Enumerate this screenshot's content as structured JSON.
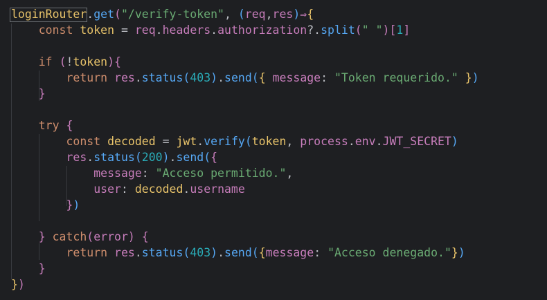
{
  "theme": {
    "background": "#1e1f22",
    "colors": {
      "text": "#bcbec4",
      "identifier": "#e8c36a",
      "property": "#c77dbb",
      "method": "#56a8f5",
      "keyword": "#cf8e6d",
      "string": "#6aab73",
      "number": "#2aacb8",
      "brace1": "#e8c36a",
      "brace2": "#c77dbb",
      "brace3": "#56a8f5",
      "guide": "#393b40"
    }
  },
  "code_lines": [
    [
      {
        "t": "loginRouter",
        "c": "identifier"
      },
      {
        "t": ".",
        "c": "text"
      },
      {
        "t": "get",
        "c": "method"
      },
      {
        "t": "(",
        "c": "brace2"
      },
      {
        "t": "\"/verify-token\"",
        "c": "string"
      },
      {
        "t": ", ",
        "c": "text"
      },
      {
        "t": "(",
        "c": "brace3"
      },
      {
        "t": "req",
        "c": "property"
      },
      {
        "t": ",",
        "c": "text"
      },
      {
        "t": "res",
        "c": "property"
      },
      {
        "t": ")",
        "c": "brace3"
      },
      {
        "t": "⇒",
        "c": "property"
      },
      {
        "t": "{",
        "c": "brace1"
      }
    ],
    [
      {
        "t": "    ",
        "c": "text"
      },
      {
        "t": "const",
        "c": "keyword"
      },
      {
        "t": " ",
        "c": "text"
      },
      {
        "t": "token",
        "c": "identifier"
      },
      {
        "t": " = ",
        "c": "text"
      },
      {
        "t": "req",
        "c": "property"
      },
      {
        "t": ".",
        "c": "text"
      },
      {
        "t": "headers",
        "c": "property"
      },
      {
        "t": ".",
        "c": "text"
      },
      {
        "t": "authorization",
        "c": "property"
      },
      {
        "t": "?.",
        "c": "text"
      },
      {
        "t": "split",
        "c": "method"
      },
      {
        "t": "(",
        "c": "brace2"
      },
      {
        "t": "\" \"",
        "c": "string"
      },
      {
        "t": ")",
        "c": "brace2"
      },
      {
        "t": "[",
        "c": "brace2"
      },
      {
        "t": "1",
        "c": "number"
      },
      {
        "t": "]",
        "c": "brace2"
      }
    ],
    [],
    [
      {
        "t": "    ",
        "c": "text"
      },
      {
        "t": "if",
        "c": "keyword"
      },
      {
        "t": " ",
        "c": "text"
      },
      {
        "t": "(",
        "c": "brace2"
      },
      {
        "t": "!",
        "c": "text"
      },
      {
        "t": "token",
        "c": "identifier"
      },
      {
        "t": ")",
        "c": "brace2"
      },
      {
        "t": "{",
        "c": "brace2"
      }
    ],
    [
      {
        "t": "        ",
        "c": "text"
      },
      {
        "t": "return",
        "c": "keyword"
      },
      {
        "t": " ",
        "c": "text"
      },
      {
        "t": "res",
        "c": "property"
      },
      {
        "t": ".",
        "c": "text"
      },
      {
        "t": "status",
        "c": "method"
      },
      {
        "t": "(",
        "c": "brace3"
      },
      {
        "t": "403",
        "c": "number"
      },
      {
        "t": ")",
        "c": "brace3"
      },
      {
        "t": ".",
        "c": "text"
      },
      {
        "t": "send",
        "c": "method"
      },
      {
        "t": "(",
        "c": "brace3"
      },
      {
        "t": "{",
        "c": "brace1"
      },
      {
        "t": " ",
        "c": "text"
      },
      {
        "t": "message",
        "c": "property"
      },
      {
        "t": ": ",
        "c": "text"
      },
      {
        "t": "\"Token requerido.\"",
        "c": "string"
      },
      {
        "t": " ",
        "c": "text"
      },
      {
        "t": "}",
        "c": "brace1"
      },
      {
        "t": ")",
        "c": "brace3"
      }
    ],
    [
      {
        "t": "    ",
        "c": "text"
      },
      {
        "t": "}",
        "c": "brace2"
      }
    ],
    [],
    [
      {
        "t": "    ",
        "c": "text"
      },
      {
        "t": "try",
        "c": "keyword"
      },
      {
        "t": " ",
        "c": "text"
      },
      {
        "t": "{",
        "c": "brace2"
      }
    ],
    [
      {
        "t": "        ",
        "c": "text"
      },
      {
        "t": "const",
        "c": "keyword"
      },
      {
        "t": " ",
        "c": "text"
      },
      {
        "t": "decoded",
        "c": "identifier"
      },
      {
        "t": " = ",
        "c": "text"
      },
      {
        "t": "jwt",
        "c": "identifier"
      },
      {
        "t": ".",
        "c": "text"
      },
      {
        "t": "verify",
        "c": "method"
      },
      {
        "t": "(",
        "c": "brace3"
      },
      {
        "t": "token",
        "c": "identifier"
      },
      {
        "t": ", ",
        "c": "text"
      },
      {
        "t": "process",
        "c": "property"
      },
      {
        "t": ".",
        "c": "text"
      },
      {
        "t": "env",
        "c": "property"
      },
      {
        "t": ".",
        "c": "text"
      },
      {
        "t": "JWT_SECRET",
        "c": "property"
      },
      {
        "t": ")",
        "c": "brace3"
      }
    ],
    [
      {
        "t": "        ",
        "c": "text"
      },
      {
        "t": "res",
        "c": "property"
      },
      {
        "t": ".",
        "c": "text"
      },
      {
        "t": "status",
        "c": "method"
      },
      {
        "t": "(",
        "c": "brace3"
      },
      {
        "t": "200",
        "c": "number"
      },
      {
        "t": ")",
        "c": "brace3"
      },
      {
        "t": ".",
        "c": "text"
      },
      {
        "t": "send",
        "c": "method"
      },
      {
        "t": "(",
        "c": "brace3"
      },
      {
        "t": "{",
        "c": "brace2"
      }
    ],
    [
      {
        "t": "            ",
        "c": "text"
      },
      {
        "t": "message",
        "c": "property"
      },
      {
        "t": ": ",
        "c": "text"
      },
      {
        "t": "\"Acceso permitido.\"",
        "c": "string"
      },
      {
        "t": ",",
        "c": "text"
      }
    ],
    [
      {
        "t": "            ",
        "c": "text"
      },
      {
        "t": "user",
        "c": "property"
      },
      {
        "t": ": ",
        "c": "text"
      },
      {
        "t": "decoded",
        "c": "identifier"
      },
      {
        "t": ".",
        "c": "text"
      },
      {
        "t": "username",
        "c": "property"
      }
    ],
    [
      {
        "t": "        ",
        "c": "text"
      },
      {
        "t": "}",
        "c": "brace2"
      },
      {
        "t": ")",
        "c": "brace3"
      }
    ],
    [],
    [
      {
        "t": "    ",
        "c": "text"
      },
      {
        "t": "}",
        "c": "brace2"
      },
      {
        "t": " ",
        "c": "text"
      },
      {
        "t": "catch",
        "c": "keyword"
      },
      {
        "t": "(",
        "c": "brace2"
      },
      {
        "t": "error",
        "c": "property"
      },
      {
        "t": ")",
        "c": "brace2"
      },
      {
        "t": " ",
        "c": "text"
      },
      {
        "t": "{",
        "c": "brace2"
      }
    ],
    [
      {
        "t": "        ",
        "c": "text"
      },
      {
        "t": "return",
        "c": "keyword"
      },
      {
        "t": " ",
        "c": "text"
      },
      {
        "t": "res",
        "c": "property"
      },
      {
        "t": ".",
        "c": "text"
      },
      {
        "t": "status",
        "c": "method"
      },
      {
        "t": "(",
        "c": "brace3"
      },
      {
        "t": "403",
        "c": "number"
      },
      {
        "t": ")",
        "c": "brace3"
      },
      {
        "t": ".",
        "c": "text"
      },
      {
        "t": "send",
        "c": "method"
      },
      {
        "t": "(",
        "c": "brace3"
      },
      {
        "t": "{",
        "c": "brace1"
      },
      {
        "t": "message",
        "c": "property"
      },
      {
        "t": ": ",
        "c": "text"
      },
      {
        "t": "\"Acceso denegado.\"",
        "c": "string"
      },
      {
        "t": "}",
        "c": "brace1"
      },
      {
        "t": ")",
        "c": "brace3"
      }
    ],
    [
      {
        "t": "    ",
        "c": "text"
      },
      {
        "t": "}",
        "c": "brace2"
      }
    ],
    [
      {
        "t": "}",
        "c": "brace1"
      },
      {
        "t": ")",
        "c": "brace2"
      }
    ]
  ]
}
